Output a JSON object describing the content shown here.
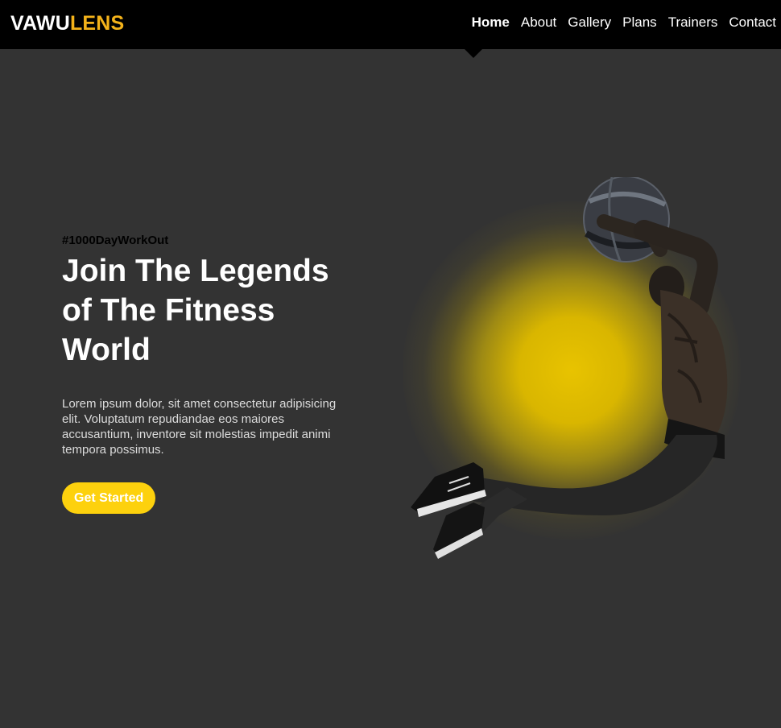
{
  "brand": {
    "name_part_1": "VAWU",
    "name_part_2": "LENS",
    "accent_color": "#f3b21a"
  },
  "nav": {
    "items": [
      {
        "label": "Home",
        "active": true
      },
      {
        "label": "About"
      },
      {
        "label": "Gallery"
      },
      {
        "label": "Plans"
      },
      {
        "label": "Trainers"
      },
      {
        "label": "Contact"
      }
    ]
  },
  "hero": {
    "hashtag": "#1000DayWorkOut",
    "headline_line_1": "Join The Legends",
    "headline_line_2": "of The Fitness",
    "headline_line_3": "World",
    "description": "Lorem ipsum dolor, sit amet consectetur adipisicing elit. Voluptatum repudiandae eos maiores accusantium, inventore sit molestias impedit animi tempora possimus.",
    "cta_label": "Get Started",
    "cta_color": "#fdd10d",
    "background_color": "#333333",
    "image_subject": "athlete-jumping-with-medicine-ball"
  }
}
